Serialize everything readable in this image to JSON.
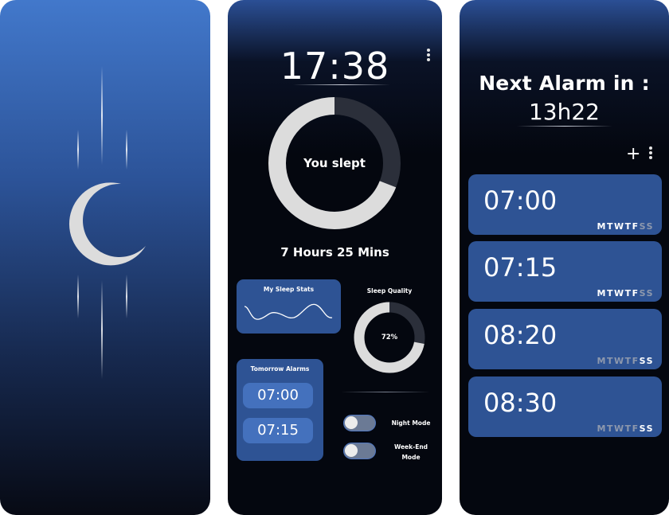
{
  "colors": {
    "accent": "#2e5394",
    "accent_light": "#4471bd",
    "ring_filled": "#dcdcdc",
    "ring_track": "#2b2f3a",
    "background": "#04070f"
  },
  "splash": {
    "icon": "crescent-moon-icon"
  },
  "home": {
    "clock": "17:38",
    "sleep_ring_label": "You slept",
    "sleep_fraction": 0.69,
    "sleep_duration": "7 Hours 25 Mins",
    "stats_card_title": "My Sleep Stats",
    "quality_title": "Sleep Quality",
    "quality_value": "72%",
    "quality_fraction": 0.72,
    "tomorrow_title": "Tomorrow Alarms",
    "tomorrow_alarms": [
      "07:00",
      "07:15"
    ],
    "toggles": [
      {
        "label_line1": "Night Mode",
        "label_line2": "",
        "on": false
      },
      {
        "label_line1": "Week-End",
        "label_line2": "Mode",
        "on": false
      }
    ]
  },
  "alarms": {
    "title": "Next Alarm in :",
    "countdown": "13h22",
    "add_icon": "+",
    "list": [
      {
        "time": "07:00",
        "days": [
          "M",
          "T",
          "W",
          "T",
          "F",
          "S",
          "S"
        ],
        "active": [
          true,
          true,
          true,
          true,
          true,
          false,
          false
        ]
      },
      {
        "time": "07:15",
        "days": [
          "M",
          "T",
          "W",
          "T",
          "F",
          "S",
          "S"
        ],
        "active": [
          true,
          true,
          true,
          true,
          true,
          false,
          false
        ]
      },
      {
        "time": "08:20",
        "days": [
          "M",
          "T",
          "W",
          "T",
          "F",
          "S",
          "S"
        ],
        "active": [
          false,
          false,
          false,
          false,
          false,
          true,
          true
        ]
      },
      {
        "time": "08:30",
        "days": [
          "M",
          "T",
          "W",
          "T",
          "F",
          "S",
          "S"
        ],
        "active": [
          false,
          false,
          false,
          false,
          false,
          true,
          true
        ]
      }
    ]
  }
}
